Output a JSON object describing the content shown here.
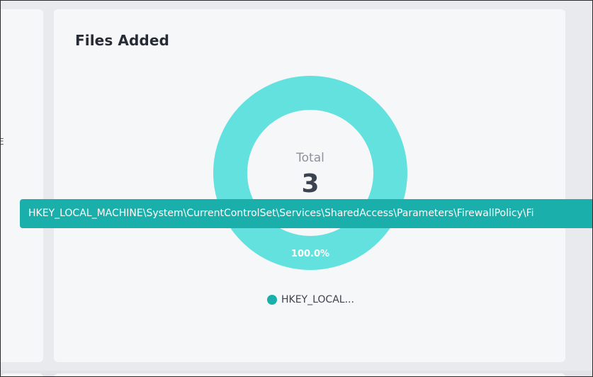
{
  "card": {
    "title": "Files Added"
  },
  "left_panel": {
    "glyph": "E"
  },
  "chart_data": {
    "type": "pie",
    "donut": true,
    "center_label": "Total",
    "center_value": "3",
    "series": [
      {
        "name": "HKEY_LOCAL_MACHINE\\System\\CurrentControlSet\\Services\\SharedAccess\\Parameters\\FirewallPolicy\\Fi",
        "value": 3,
        "percent_label": "100.0%",
        "color": "#63e1df",
        "legend_color": "#1aafaa"
      }
    ],
    "legend": [
      {
        "label": "HKEY_LOCAL...",
        "color": "#1aafaa"
      }
    ],
    "tooltip": "HKEY_LOCAL_MACHINE\\System\\CurrentControlSet\\Services\\SharedAccess\\Parameters\\FirewallPolicy\\Fi"
  }
}
